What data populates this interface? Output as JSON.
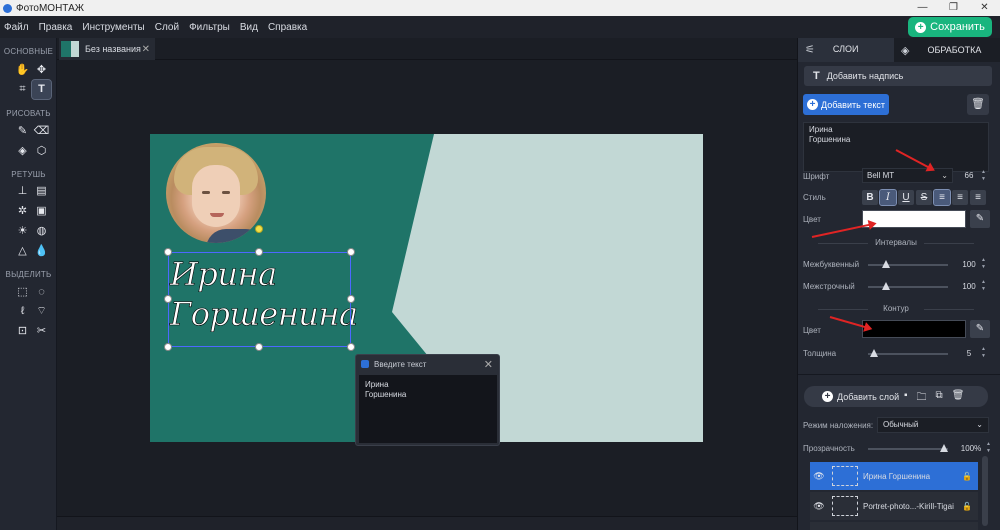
{
  "window": {
    "title": "ФотоМОНТАЖ"
  },
  "menu": [
    "Файл",
    "Правка",
    "Инструменты",
    "Слой",
    "Фильтры",
    "Вид",
    "Справка"
  ],
  "save_button": "Сохранить",
  "tools": {
    "sections": [
      "ОСНОВНЫЕ",
      "РИСОВАТЬ",
      "РЕТУШЬ",
      "ВЫДЕЛИТЬ"
    ],
    "icons": [
      "hand-icon",
      "move-icon",
      "crop-icon",
      "text-icon",
      "brush-icon",
      "eraser-icon",
      "fill-icon",
      "shapes-icon",
      "stamp-icon",
      "patch-icon",
      "heal-icon",
      "frame-icon",
      "brightness-icon",
      "blur-icon",
      "sharpen-icon",
      "drop-icon",
      "rect-select-icon",
      "ellipse-select-icon",
      "lasso-icon",
      "poly-lasso-icon",
      "magic-wand-icon"
    ]
  },
  "document": {
    "tab_name": "Без названия"
  },
  "canvas": {
    "text": "Ирина\nГоршенина",
    "colors": {
      "dark": "#1f7468",
      "light": "#c2d8d5"
    }
  },
  "popup": {
    "title": "Введите текст",
    "content": "Ирина\nГоршенина"
  },
  "right_panel": {
    "tabs": [
      "СЛОИ",
      "ОБРАБОТКА"
    ],
    "add_title_label": "Добавить надпись",
    "add_text_button": "Добавить текст",
    "text_value": "Ирина\nГоршенина",
    "font_label": "Шрифт",
    "font_value": "Bell MT",
    "font_size": "66",
    "style_label": "Стиль",
    "style_buttons": [
      "B",
      "I",
      "U",
      "S"
    ],
    "color_label": "Цвет",
    "text_color": "#ffffff",
    "intervals_section": "Интервалы",
    "letter_spacing_label": "Межбуквенный",
    "letter_spacing_value": "100",
    "letter_spacing_level": 0.2,
    "line_spacing_label": "Межстрочный",
    "line_spacing_value": "100",
    "line_spacing_level": 0.2,
    "outline_section": "Контур",
    "outline_color_label": "Цвет",
    "outline_color": "#000000",
    "thickness_label": "Толщина",
    "thickness_value": "5",
    "thickness_level": 0.03,
    "add_layer_button": "Добавить слой",
    "blend_label": "Режим наложения:",
    "blend_value": "Обычный",
    "opacity_label": "Прозрачность",
    "opacity_value": "100%",
    "opacity_level": 1.0,
    "layers": [
      {
        "name": "Ирина  Горшенина",
        "selected": true
      },
      {
        "name": "Portret-photo...-Kirill-Tigai",
        "selected": false
      }
    ]
  }
}
